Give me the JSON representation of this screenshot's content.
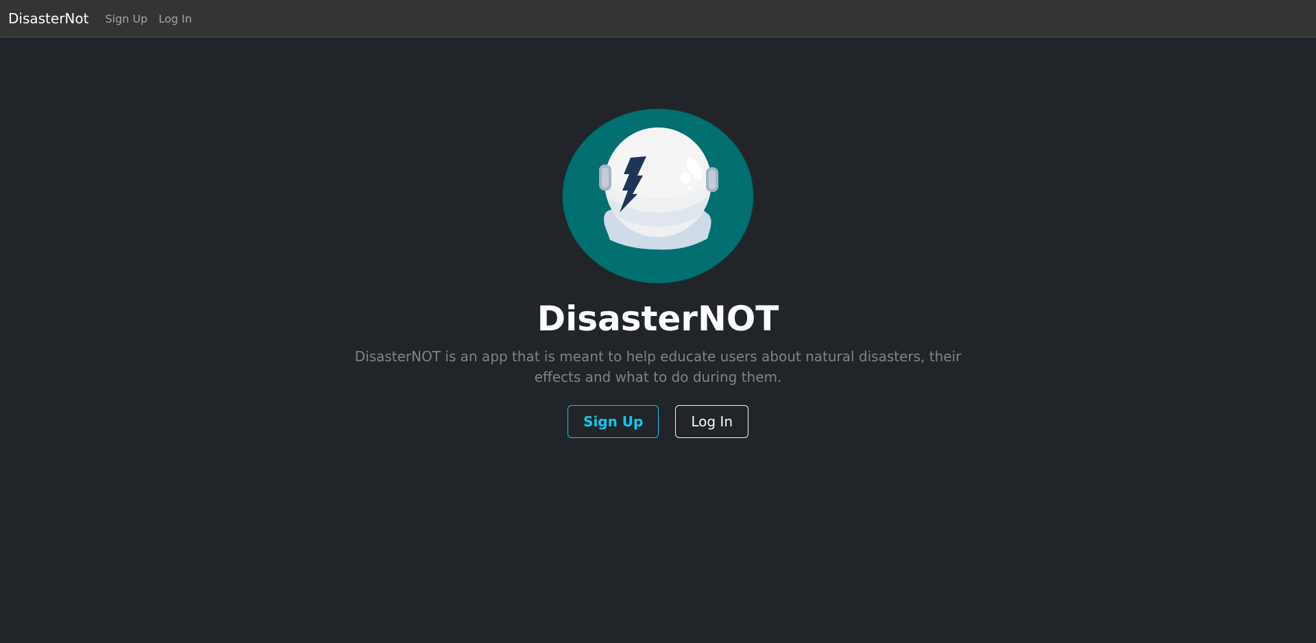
{
  "navbar": {
    "brand": "DisasterNot",
    "links": [
      {
        "label": "Sign Up"
      },
      {
        "label": "Log In"
      }
    ]
  },
  "hero": {
    "logo_icon": "astronaut-helmet-lightning-icon",
    "title": "DisasterNOT",
    "lead": "DisasterNOT is an app that is meant to help educate users about natural disasters, their effects and what to do during them.",
    "signup_label": "Sign Up",
    "login_label": "Log In"
  },
  "colors": {
    "background": "#212529",
    "navbar": "#343434",
    "logo_circle": "#027071",
    "accent": "#0dcaf0"
  }
}
